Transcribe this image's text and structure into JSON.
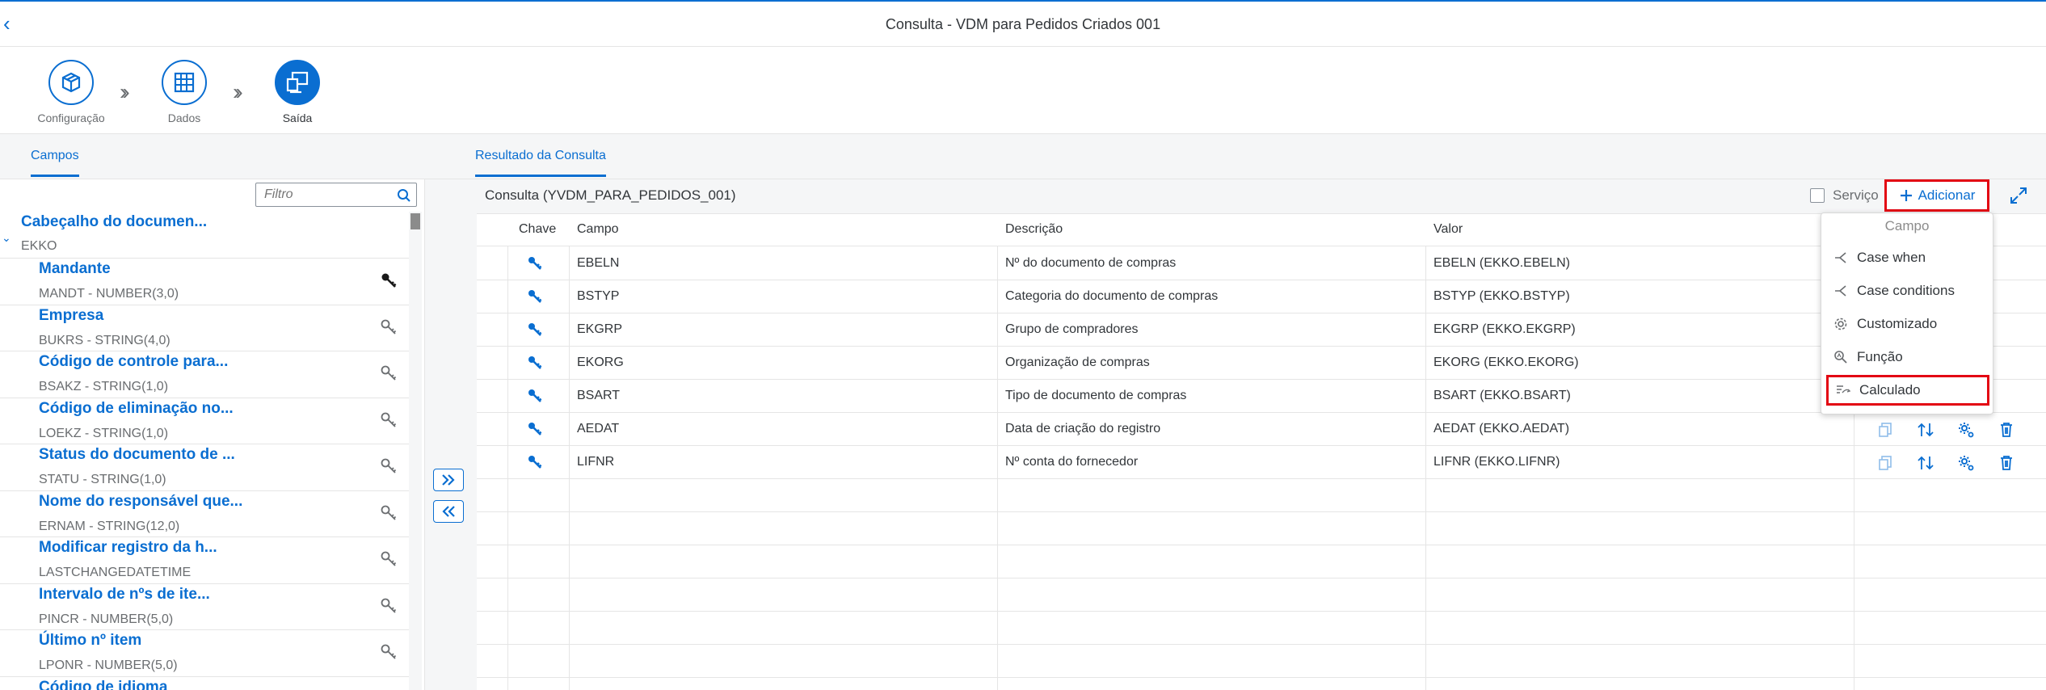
{
  "header": {
    "title": "Consulta - VDM para Pedidos Criados 001"
  },
  "wizard": {
    "steps": [
      {
        "label": "Configuração"
      },
      {
        "label": "Dados"
      },
      {
        "label": "Saída"
      }
    ]
  },
  "tabs": {
    "left": "Campos",
    "right": "Resultado da Consulta"
  },
  "left_panel": {
    "filter_placeholder": "Filtro",
    "group": {
      "title": "Cabeçalho do documen...",
      "subtitle": "EKKO"
    },
    "fields": [
      {
        "name": "Mandante",
        "type": "MANDT - NUMBER(3,0)"
      },
      {
        "name": "Empresa",
        "type": "BUKRS - STRING(4,0)"
      },
      {
        "name": "Código de controle para...",
        "type": "BSAKZ - STRING(1,0)"
      },
      {
        "name": "Código de eliminação no...",
        "type": "LOEKZ - STRING(1,0)"
      },
      {
        "name": "Status do documento de ...",
        "type": "STATU - STRING(1,0)"
      },
      {
        "name": "Nome do responsável que...",
        "type": "ERNAM - STRING(12,0)"
      },
      {
        "name": "Modificar registro da h...",
        "type": "LASTCHANGEDATETIME"
      },
      {
        "name": "Intervalo de nºs de ite...",
        "type": "PINCR - NUMBER(5,0)"
      },
      {
        "name": "Último nº item",
        "type": "LPONR - NUMBER(5,0)"
      },
      {
        "name": "Código de idioma",
        "type": ""
      }
    ]
  },
  "right_panel": {
    "toolbar_title": "Consulta (YVDM_PARA_PEDIDOS_001)",
    "service_label": "Serviço",
    "add_label": "Adicionar",
    "columns": {
      "key": "Chave",
      "field": "Campo",
      "description": "Descrição",
      "value": "Valor"
    },
    "rows": [
      {
        "field": "EBELN",
        "description": "Nº do documento de compras",
        "value": "EBELN (EKKO.EBELN)"
      },
      {
        "field": "BSTYP",
        "description": "Categoria do documento de compras",
        "value": "BSTYP (EKKO.BSTYP)"
      },
      {
        "field": "EKGRP",
        "description": "Grupo de compradores",
        "value": "EKGRP (EKKO.EKGRP)"
      },
      {
        "field": "EKORG",
        "description": "Organização de compras",
        "value": "EKORG (EKKO.EKORG)"
      },
      {
        "field": "BSART",
        "description": "Tipo de documento de compras",
        "value": "BSART (EKKO.BSART)"
      },
      {
        "field": "AEDAT",
        "description": "Data de criação do registro",
        "value": "AEDAT (EKKO.AEDAT)"
      },
      {
        "field": "LIFNR",
        "description": "Nº conta do fornecedor",
        "value": "LIFNR (EKKO.LIFNR)"
      }
    ]
  },
  "add_menu": {
    "header": "Campo",
    "items": [
      {
        "label": "Case when",
        "icon": "branch-icon"
      },
      {
        "label": "Case conditions",
        "icon": "branch-icon"
      },
      {
        "label": "Customizado",
        "icon": "gear-icon"
      },
      {
        "label": "Função",
        "icon": "function-search-icon"
      },
      {
        "label": "Calculado",
        "icon": "calculated-icon"
      }
    ]
  },
  "colors": {
    "accent": "#0a6ed1",
    "highlight": "#e30613"
  }
}
